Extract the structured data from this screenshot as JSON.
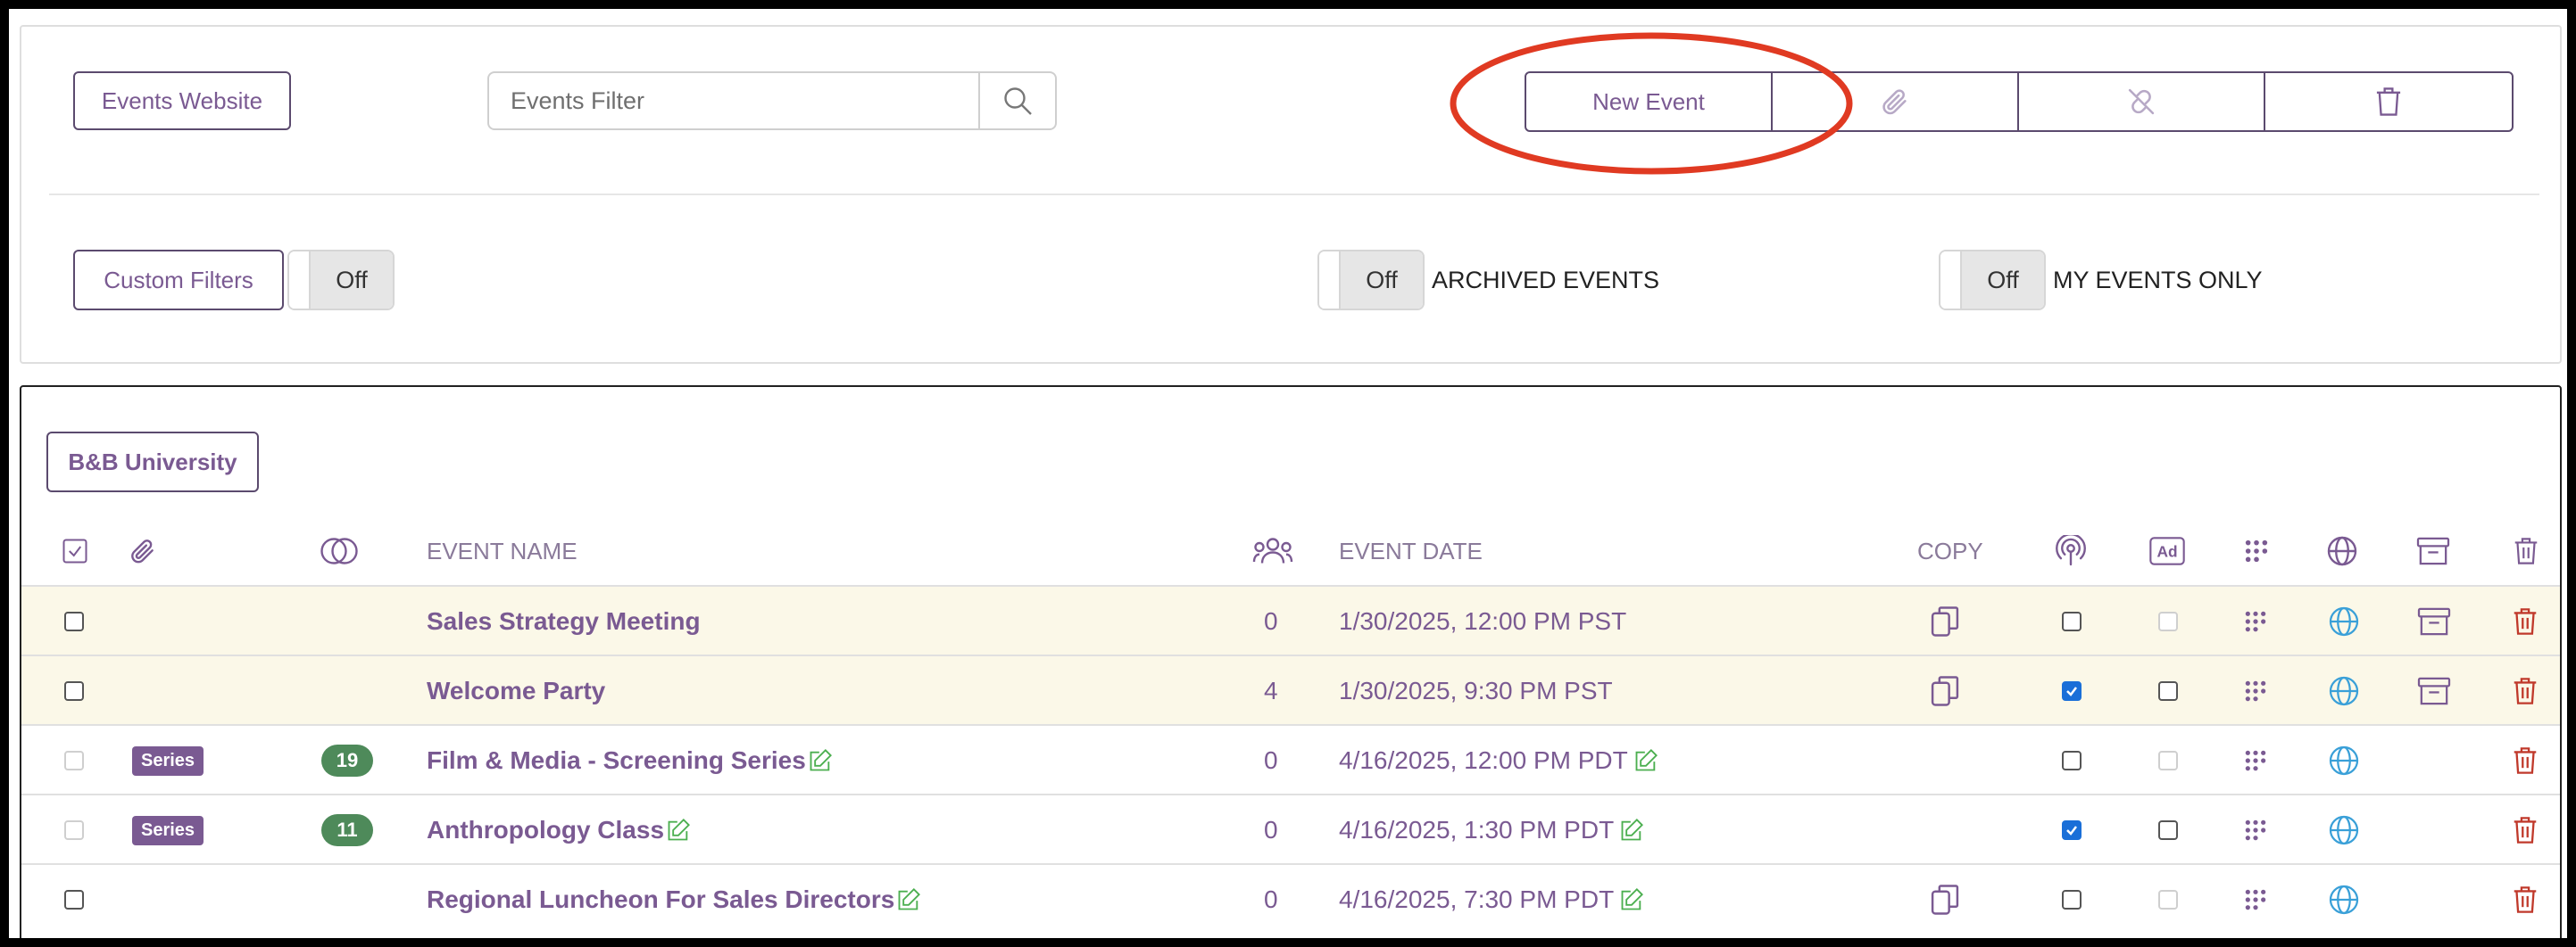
{
  "toolbar": {
    "events_website_label": "Events Website",
    "search_placeholder": "Events Filter",
    "new_event_label": "New Event"
  },
  "filters": {
    "custom_filters_label": "Custom Filters",
    "custom_filters_state": "Off",
    "archived_state": "Off",
    "archived_label": "ARCHIVED EVENTS",
    "my_events_state": "Off",
    "my_events_label": "MY EVENTS ONLY"
  },
  "table": {
    "group_label": "B&B University",
    "headers": {
      "event_name": "EVENT NAME",
      "event_date": "EVENT DATE",
      "copy": "COPY"
    },
    "rows": [
      {
        "name": "Sales Strategy Meeting",
        "count": "0",
        "date": "1/30/2025, 12:00 PM PST",
        "badge": "",
        "pill": ""
      },
      {
        "name": "Welcome Party",
        "count": "4",
        "date": "1/30/2025, 9:30 PM PST",
        "badge": "",
        "pill": ""
      },
      {
        "name": "Film & Media - Screening Series",
        "count": "0",
        "date": "4/16/2025, 12:00 PM PDT",
        "badge": "Series",
        "pill": "19"
      },
      {
        "name": "Anthropology Class",
        "count": "0",
        "date": "4/16/2025, 1:30 PM PDT",
        "badge": "Series",
        "pill": "11"
      },
      {
        "name": "Regional Luncheon For Sales Directors",
        "count": "0",
        "date": "4/16/2025, 7:30 PM PDT",
        "badge": "",
        "pill": ""
      }
    ]
  },
  "colors": {
    "brand_purple": "#7a5a92",
    "highlight_row": "#fbf8e8",
    "annotation_red": "#e03a22",
    "delete_red": "#c0392b",
    "globe_blue": "#3aa0d8",
    "edit_green": "#4caf50"
  }
}
